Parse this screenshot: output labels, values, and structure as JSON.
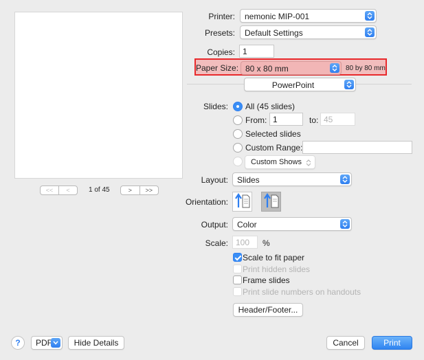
{
  "printer": {
    "label": "Printer:",
    "value": "nemonic MIP-001"
  },
  "presets": {
    "label": "Presets:",
    "value": "Default Settings"
  },
  "copies": {
    "label": "Copies:",
    "value": "1"
  },
  "paper_size": {
    "label": "Paper Size:",
    "value": "80 x 80 mm",
    "dimensions": "80 by 80 mm",
    "highlight_color": "#e8292c"
  },
  "app_menu": {
    "value": "PowerPoint"
  },
  "preview": {
    "page_indicator": "1 of 45",
    "first_label": "<<",
    "prev_label": "<",
    "next_label": ">",
    "last_label": ">>"
  },
  "slides": {
    "label": "Slides:",
    "all_label": "All  (45 slides)",
    "from_label": "From:",
    "from_value": "1",
    "to_label": "to:",
    "to_value": "45",
    "selected_label": "Selected slides",
    "custom_range_label": "Custom Range:",
    "custom_range_value": "",
    "custom_shows_value": "Custom Shows"
  },
  "layout": {
    "label": "Layout:",
    "value": "Slides"
  },
  "orientation": {
    "label": "Orientation:"
  },
  "output": {
    "label": "Output:",
    "value": "Color"
  },
  "scale": {
    "label": "Scale:",
    "value": "100",
    "unit": "%"
  },
  "options": {
    "scale_to_fit": "Scale to fit paper",
    "print_hidden": "Print hidden slides",
    "frame_slides": "Frame slides",
    "print_numbers": "Print slide numbers on handouts"
  },
  "header_footer_button": "Header/Footer...",
  "footer": {
    "help_label": "?",
    "pdf_label": "PDF",
    "hide_details_label": "Hide Details",
    "cancel_label": "Cancel",
    "print_label": "Print"
  },
  "colors": {
    "accent": "#2f7ff0",
    "background": "#ececec"
  }
}
